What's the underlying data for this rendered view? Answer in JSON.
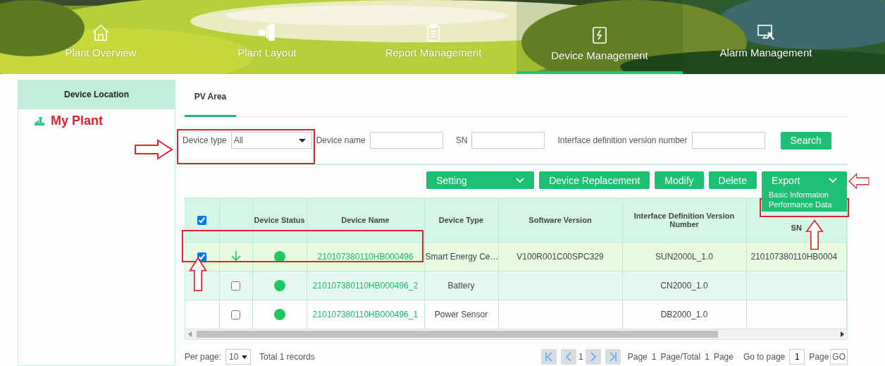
{
  "nav": [
    {
      "label": "Plant Overview",
      "selected": false
    },
    {
      "label": "Plant Layout",
      "selected": false
    },
    {
      "label": "Report Management",
      "selected": false
    },
    {
      "label": "Device Management",
      "selected": true
    },
    {
      "label": "Alarm Management",
      "selected": false
    }
  ],
  "sidebar": {
    "title": "Device Location",
    "tree": [
      {
        "label": "My Plant"
      }
    ]
  },
  "tabs": [
    {
      "label": "PV Area",
      "selected": true
    }
  ],
  "filters": [
    {
      "kind": "select",
      "label": "Device type",
      "value": "All"
    },
    {
      "kind": "text",
      "label": "Device name"
    },
    {
      "kind": "text",
      "label": "SN"
    },
    {
      "kind": "text",
      "label": "Interface definition version number"
    }
  ],
  "search_button": "Search",
  "toolbar": [
    {
      "kind": "menu",
      "label": "Setting",
      "expanded": false
    },
    {
      "kind": "button",
      "label": "Device Replacement"
    },
    {
      "kind": "button",
      "label": "Modify"
    },
    {
      "kind": "button",
      "label": "Delete"
    },
    {
      "kind": "menu",
      "label": "Export",
      "expanded": true
    }
  ],
  "export_menu": [
    {
      "label": "Basic Information"
    },
    {
      "label": "Performance Data"
    }
  ],
  "table": {
    "select_all": true,
    "columns": [
      "Device Status",
      "Device Name",
      "Device Type",
      "Software Version",
      "Interface Definition Version Number",
      "SN"
    ],
    "rows": [
      {
        "kind": "device",
        "selected": true,
        "checked": true,
        "name": "210107380110HB000496",
        "type": "Smart Energy Ce…",
        "software": "V100R001C00SPC329",
        "interface": "SUN2000L_1.0",
        "sn": "210107380110HB0004"
      },
      {
        "kind": "subdevice",
        "selected": false,
        "checked": false,
        "name": "210107380110HB000496_2",
        "type": "Battery",
        "interface": "CN2000_1.0"
      },
      {
        "kind": "subdevice",
        "selected": false,
        "checked": false,
        "name": "210107380110HB000496_1",
        "type": "Power Sensor",
        "interface": "DB2000_1.0"
      }
    ]
  },
  "footer": {
    "per_page_label": "Per page:",
    "per_page": "10",
    "total": "Total 1 records",
    "current_page": "1",
    "page_label": "Page",
    "page": "1",
    "total_label": "Page/Total",
    "total_pages": "1",
    "page_suffix": "Page",
    "goto_label": "Go to page",
    "goto_value": "1",
    "goto_suffix": "Page",
    "go_button": "GO"
  },
  "annotations": [
    {
      "kind": "arrow"
    },
    {
      "kind": "frame"
    },
    {
      "kind": "arrow"
    },
    {
      "kind": "frame"
    },
    {
      "kind": "frame"
    },
    {
      "kind": "arrow"
    },
    {
      "kind": "arrow"
    }
  ]
}
